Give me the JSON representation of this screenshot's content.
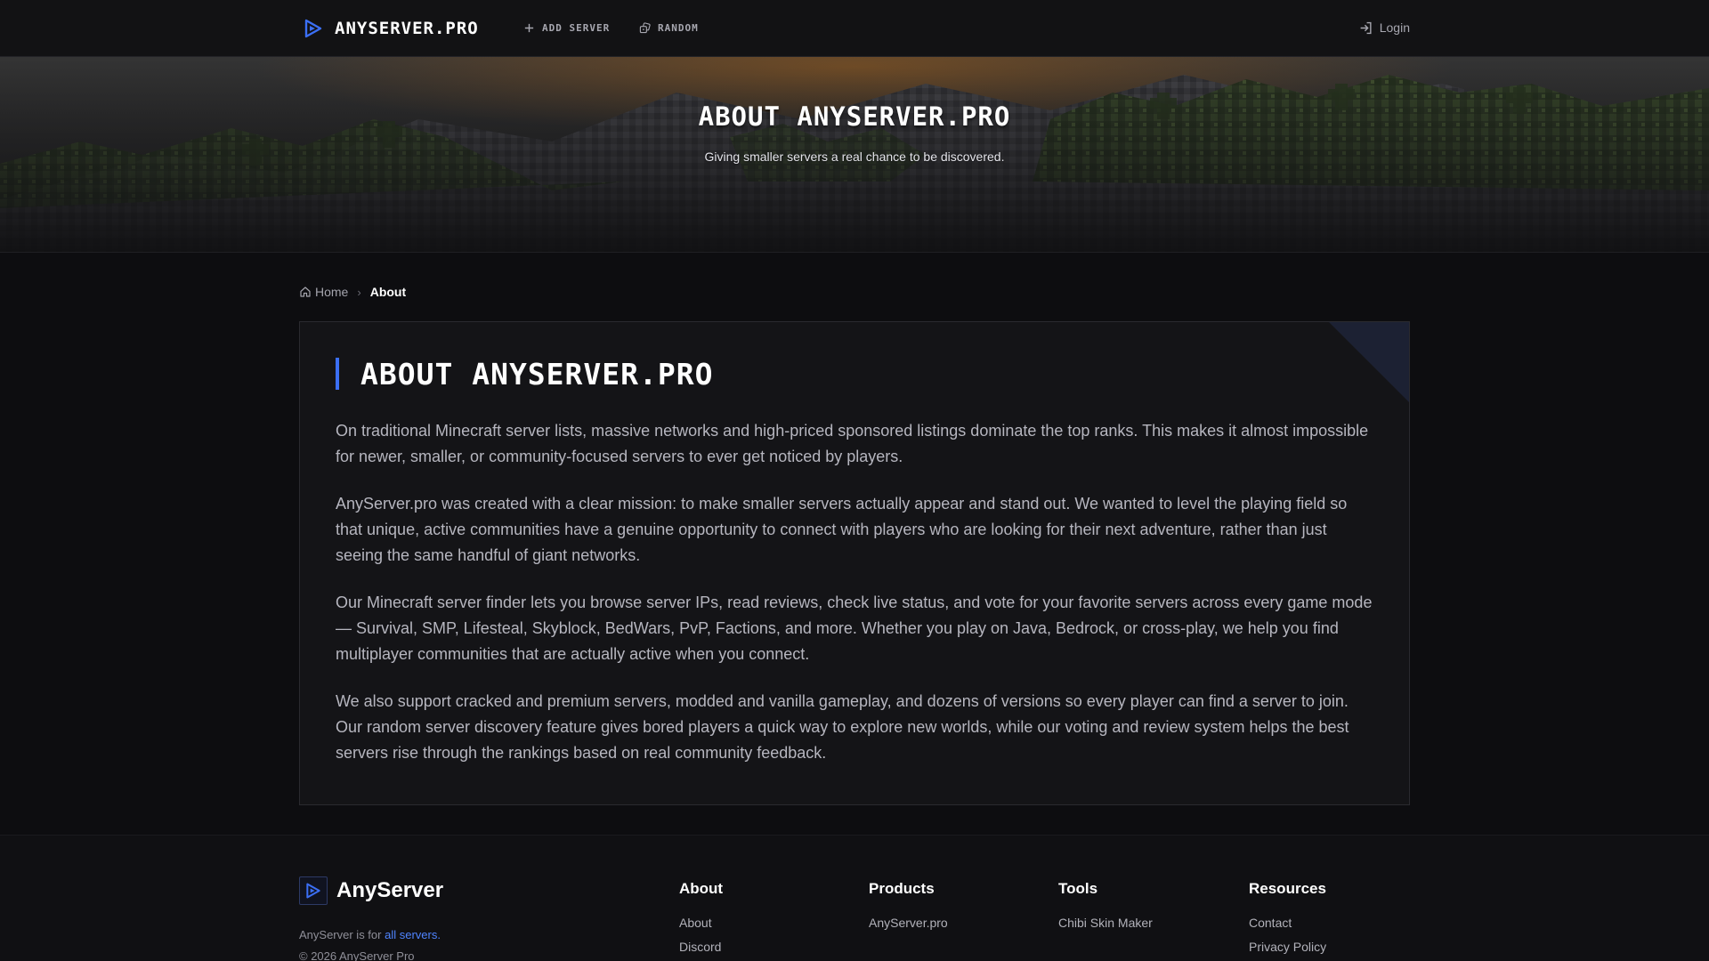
{
  "header": {
    "brand": "ANYSERVER.PRO",
    "nav": [
      {
        "label": "ADD SERVER",
        "icon": "plus-icon"
      },
      {
        "label": "RANDOM",
        "icon": "dice-icon"
      }
    ],
    "login_label": "Login",
    "accent_color": "#3b6ff5"
  },
  "hero": {
    "title": "ABOUT ANYSERVER.PRO",
    "subtitle": "Giving smaller servers a real chance to be discovered."
  },
  "breadcrumb": {
    "home": "Home",
    "current": "About"
  },
  "about": {
    "title": "ABOUT ANYSERVER.PRO",
    "paragraphs": [
      "On traditional Minecraft server lists, massive networks and high-priced sponsored listings dominate the top ranks. This makes it almost impossible for newer, smaller, or community-focused servers to ever get noticed by players.",
      "AnyServer.pro was created with a clear mission: to make smaller servers actually appear and stand out. We wanted to level the playing field so that unique, active communities have a genuine opportunity to connect with players who are looking for their next adventure, rather than just seeing the same handful of giant networks.",
      "Our Minecraft server finder lets you browse server IPs, read reviews, check live status, and vote for your favorite servers across every game mode — Survival, SMP, Lifesteal, Skyblock, BedWars, PvP, Factions, and more. Whether you play on Java, Bedrock, or cross-play, we help you find multiplayer communities that are actually active when you connect.",
      "We also support cracked and premium servers, modded and vanilla gameplay, and dozens of versions so every player can find a server to join. Our random server discovery feature gives bored players a quick way to explore new worlds, while our voting and review system helps the best servers rise through the rankings based on real community feedback."
    ]
  },
  "footer": {
    "brand": "AnyServer",
    "tagline_prefix": "AnyServer is for ",
    "tagline_link": "all servers.",
    "copyright": "© 2026 AnyServer Pro",
    "columns": [
      {
        "title": "About",
        "links": [
          "About",
          "Discord"
        ]
      },
      {
        "title": "Products",
        "links": [
          "AnyServer.pro"
        ]
      },
      {
        "title": "Tools",
        "links": [
          "Chibi Skin Maker"
        ]
      },
      {
        "title": "Resources",
        "links": [
          "Contact",
          "Privacy Policy"
        ]
      }
    ]
  }
}
